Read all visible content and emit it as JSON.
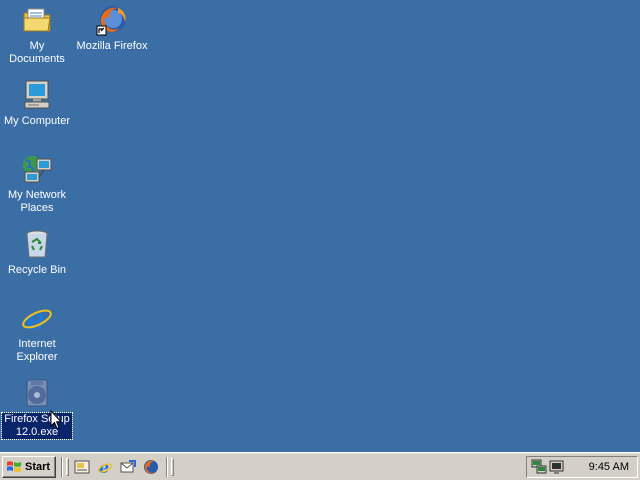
{
  "desktop": {
    "background_color": "#3a6ea5",
    "icons": [
      {
        "label": "My Documents",
        "icon": "folder-documents-icon"
      },
      {
        "label": "Mozilla Firefox",
        "icon": "firefox-shortcut-icon"
      },
      {
        "label": "My Computer",
        "icon": "computer-icon"
      },
      {
        "label": "My Network Places",
        "icon": "network-places-icon"
      },
      {
        "label": "Recycle Bin",
        "icon": "recycle-bin-icon"
      },
      {
        "label": "Internet Explorer",
        "icon": "internet-explorer-icon"
      },
      {
        "label": "Firefox Setup 12.0.exe",
        "icon": "firefox-setup-icon",
        "selected": true
      }
    ]
  },
  "taskbar": {
    "start_label": "Start",
    "quick_launch": [
      {
        "name": "show-desktop-icon"
      },
      {
        "name": "internet-explorer-icon"
      },
      {
        "name": "outlook-express-icon"
      },
      {
        "name": "firefox-icon"
      }
    ],
    "tray": {
      "icons": [
        "network-icon",
        "display-icon"
      ],
      "clock": "9:45 AM"
    }
  }
}
